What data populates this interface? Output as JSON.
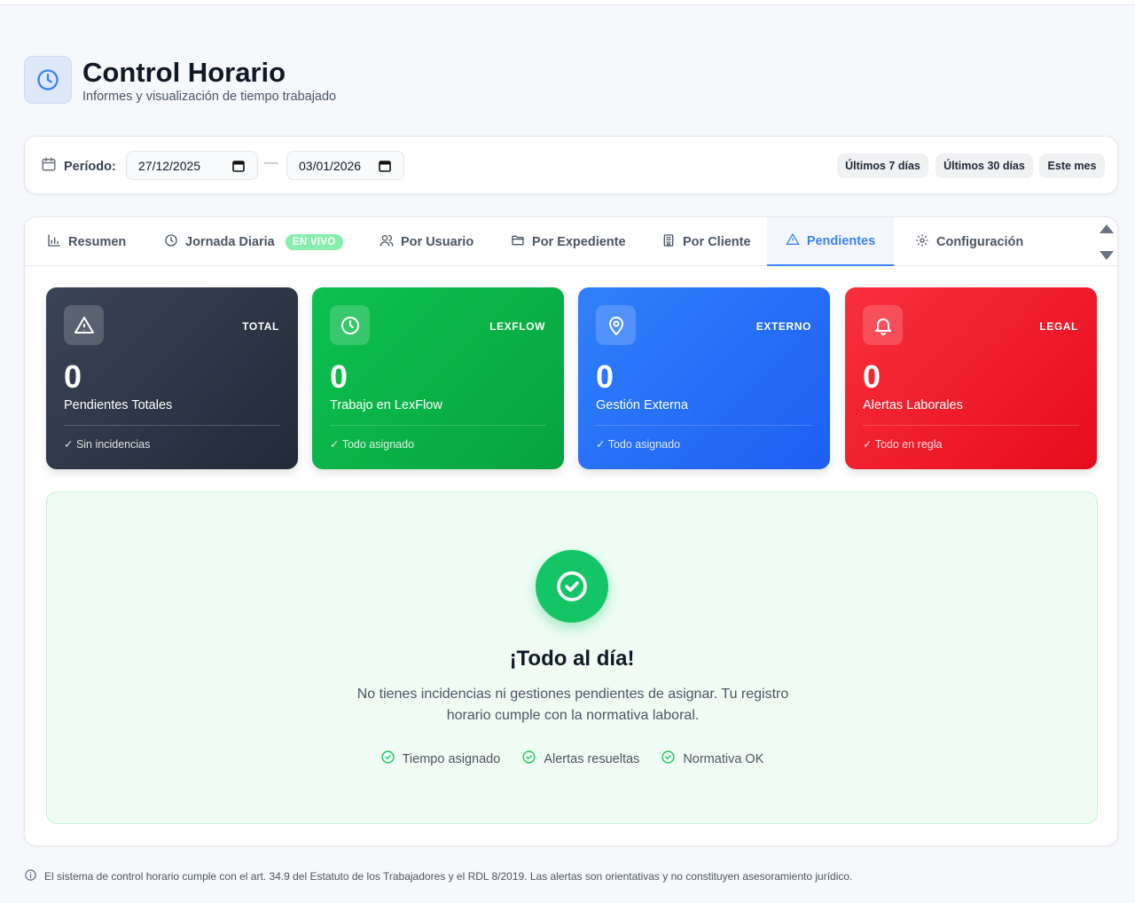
{
  "header": {
    "title": "Control Horario",
    "subtitle": "Informes y visualización de tiempo trabajado",
    "icon": "clock-icon"
  },
  "filters": {
    "period_label": "Período:",
    "date_from": "27/12/2025",
    "date_to": "03/01/2026",
    "separator": "—",
    "quick_ranges": [
      "Últimos 7 días",
      "Últimos 30 días",
      "Este mes"
    ]
  },
  "tabs": [
    {
      "label": "Resumen",
      "icon": "bar-chart-icon",
      "active": false
    },
    {
      "label": "Jornada Diaria",
      "icon": "clock-icon",
      "active": false,
      "badge": "EN VIVO"
    },
    {
      "label": "Por Usuario",
      "icon": "users-icon",
      "active": false
    },
    {
      "label": "Por Expediente",
      "icon": "folder-icon",
      "active": false
    },
    {
      "label": "Por Cliente",
      "icon": "building-icon",
      "active": false
    },
    {
      "label": "Pendientes",
      "icon": "warning-icon",
      "active": true
    },
    {
      "label": "Configuración",
      "icon": "gear-icon",
      "active": false
    }
  ],
  "stats": [
    {
      "tag": "TOTAL",
      "value": "0",
      "label": "Pendientes Totales",
      "footer": "✓ Sin incidencias",
      "icon": "warning-icon",
      "color": "#2b3445"
    },
    {
      "tag": "LEXFLOW",
      "value": "0",
      "label": "Trabajo en LexFlow",
      "footer": "✓ Todo asignado",
      "icon": "clock-icon",
      "color": "#0bb74a"
    },
    {
      "tag": "EXTERNO",
      "value": "0",
      "label": "Gestión Externa",
      "footer": "✓ Todo asignado",
      "icon": "map-pin-icon",
      "color": "#2466f5"
    },
    {
      "tag": "LEGAL",
      "value": "0",
      "label": "Alertas Laborales",
      "footer": "✓ Todo en regla",
      "icon": "bell-icon",
      "color": "#ed1428"
    }
  ],
  "success": {
    "title": "¡Todo al día!",
    "message": "No tienes incidencias ni gestiones pendientes de asignar. Tu registro horario cumple con la normativa laboral.",
    "checks": [
      "Tiempo asignado",
      "Alertas resueltas",
      "Normativa OK"
    ],
    "accent": "#14c566"
  },
  "footer": {
    "note": "El sistema de control horario cumple con el art. 34.9 del Estatuto de los Trabajadores y el RDL 8/2019. Las alertas son orientativas y no constituyen asesoramiento jurídico."
  }
}
